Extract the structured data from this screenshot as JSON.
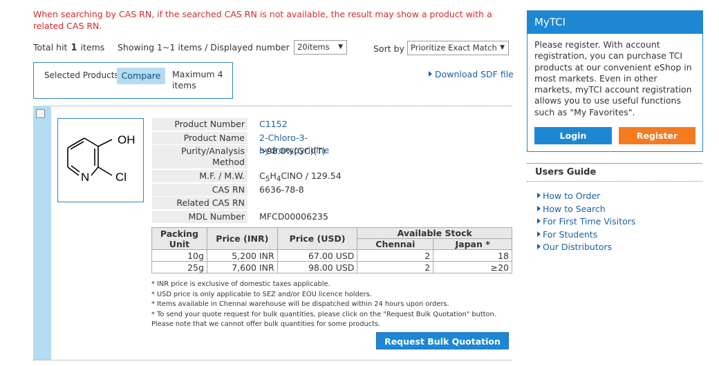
{
  "warning": "When searching by CAS RN, if the searched CAS RN is not available, the result may show a product with a related CAS RN.",
  "hitbar": {
    "total_label": "Total hit",
    "total_count": "1",
    "items_label": "items",
    "showing": "Showing 1∼1 items / Displayed number",
    "per_page_value": "20items",
    "sort_label": "Sort by",
    "sort_value": "Prioritize Exact Match"
  },
  "selected": {
    "label": "Selected Products",
    "compare_label": "Compare",
    "max_text": "Maximum 4 items"
  },
  "download_sdf": "Download SDF file",
  "product": {
    "labels": {
      "number": "Product Number",
      "name": "Product Name",
      "purity": "Purity/Analysis Method",
      "mfmw": "M.F. / M.W.",
      "cas": "CAS RN",
      "related_cas": "Related CAS RN",
      "mdl": "MDL Number"
    },
    "number": "C1152",
    "name": "2-Chloro-3-hydroxypyridine",
    "purity": ">98.0%(GC)(T)",
    "mf_prefix": "C",
    "mf_sub1": "5",
    "mf_mid": "H",
    "mf_sub2": "4",
    "mf_rest": "ClNO / 129.54",
    "cas": "6636-78-8",
    "related_cas": "",
    "mdl": "MFCD00006235",
    "structure_labels": {
      "oh": "OH",
      "n": "N",
      "cl": "Cl"
    }
  },
  "packing": {
    "headers": {
      "unit": "Packing Unit",
      "inr": "Price (INR)",
      "usd": "Price (USD)",
      "stock": "Available Stock",
      "chennai": "Chennai",
      "japan": "Japan *"
    },
    "rows": [
      {
        "unit": "10g",
        "inr": "5,200 INR",
        "usd": "67.00 USD",
        "chennai": "2",
        "japan": "18"
      },
      {
        "unit": "25g",
        "inr": "7,600 INR",
        "usd": "98.00 USD",
        "chennai": "2",
        "japan": "≥20"
      }
    ]
  },
  "notes": [
    "* INR price is exclusive of domestic taxes applicable.",
    "* USD price is only applicable to SEZ and/or EOU licence holders.",
    "* Items available in Chennai warehouse will be dispatched within 24 hours upon orders.",
    "* To send your quote request for bulk quantities, please click on the \"Request Bulk Quotation\" button. Please note that we cannot offer bulk quantities for some products."
  ],
  "bulk_button": "Request Bulk Quotation",
  "mytci": {
    "title": "MyTCI",
    "text": "Please register. With account registration, you can purchase TCI products at our convenient eShop in most markets. Even in other markets, myTCI account registration allows you to use useful functions such as \"My Favorites\".",
    "login": "Login",
    "register": "Register"
  },
  "guide": {
    "title": "Users Guide",
    "items": [
      "How to Order",
      "How to Search",
      "For First Time Visitors",
      "For Students",
      "Our Distributors"
    ]
  },
  "colors": {
    "accent": "#1d87d4",
    "register": "#f47b20",
    "warning": "#d42a2a",
    "stripe": "#b3dcf2"
  }
}
